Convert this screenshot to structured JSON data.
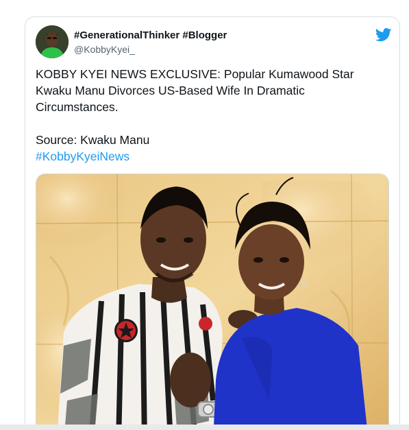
{
  "tweet": {
    "display_name": "#GenerationalThinker #Blogger",
    "handle": "@KobbyKyei_",
    "text_line1": "KOBBY KYEI NEWS EXCLUSIVE: Popular Kumawood Star Kwaku Manu Divorces US-Based Wife In Dramatic Circumstances.",
    "source": "Source: Kwaku Manu",
    "hashtag": "#KobbyKyeiNews",
    "avatar_icon": "person-avatar-icon",
    "logo_icon": "twitter-bird-icon",
    "photo_icon": "couple-photo-image"
  },
  "colors": {
    "hashtag_blue": "#1d9bf0",
    "twitter_blue": "#1d9bf0",
    "text_dark": "#0f1419",
    "text_gray": "#536471",
    "dress_blue": "#1f33c9"
  }
}
